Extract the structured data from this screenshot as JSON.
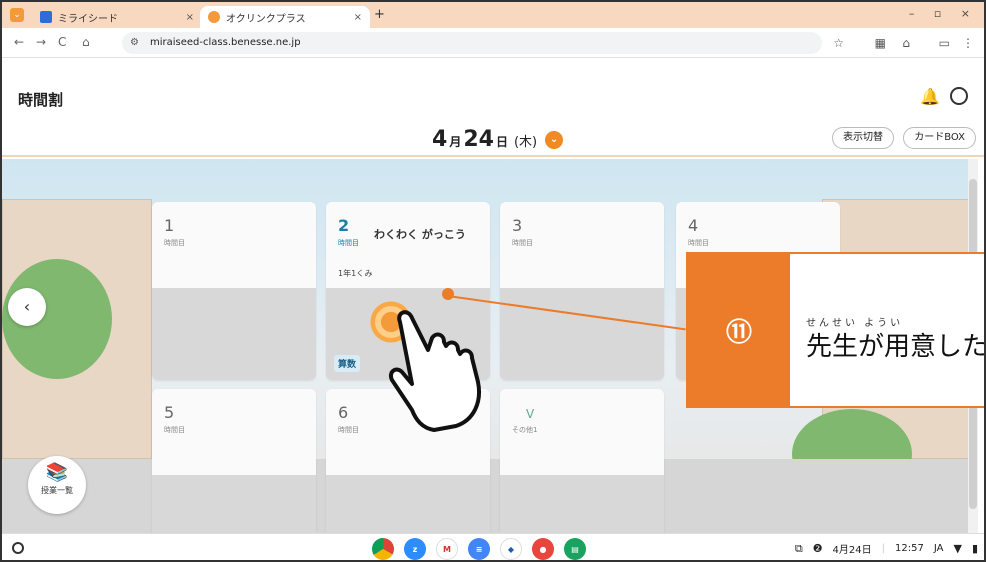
{
  "browser": {
    "tabs": [
      {
        "label": "ミライシード",
        "close": "×"
      },
      {
        "label": "オクリンクプラス",
        "close": "×"
      }
    ],
    "new_tab": "+",
    "window_controls": "– ▫ ×",
    "url": "miraiseed-class.benesse.ne.jp"
  },
  "app": {
    "title": "時間割",
    "date": {
      "month": "4",
      "month_unit": "月",
      "day": "24",
      "day_unit": "日",
      "weekday": "(木)"
    },
    "buttons": {
      "display_switch": "表示切替",
      "card_box": "カードBOX"
    }
  },
  "periods": [
    {
      "num": "1",
      "label": "時間目",
      "subject": "",
      "class": "",
      "tag": ""
    },
    {
      "num": "2",
      "label": "時間目",
      "subject": "わくわく がっこう",
      "class": "1年1くみ",
      "tag": "算数"
    },
    {
      "num": "3",
      "label": "時間目",
      "subject": "",
      "class": "",
      "tag": ""
    },
    {
      "num": "4",
      "label": "時間目",
      "subject": "",
      "class": "",
      "tag": ""
    },
    {
      "num": "5",
      "label": "時間目",
      "subject": "",
      "class": "",
      "tag": ""
    },
    {
      "num": "6",
      "label": "時間目",
      "subject": "",
      "class": "",
      "tag": ""
    },
    {
      "num": "",
      "label": "その他1",
      "subject": "",
      "class": "",
      "tag": ""
    }
  ],
  "lesson_list_label": "授業一覧",
  "callout": {
    "number": "⑪",
    "text": "先生が用意した",
    "ruby": "せんせい  ようい"
  },
  "shelf": {
    "date": "4月24日",
    "time": "12:57",
    "ime": "JA"
  },
  "colors": {
    "accent": "#ec7b2a",
    "active_period": "#1a7fa6",
    "tab_strip": "#f8d9c0"
  }
}
